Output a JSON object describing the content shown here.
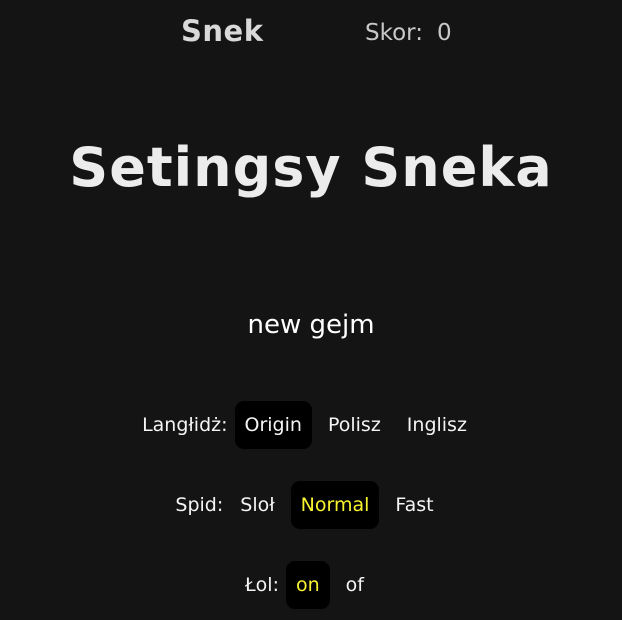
{
  "header": {
    "title": "Snek",
    "score_label": "Skor:",
    "score_value": "0"
  },
  "settings": {
    "heading": "Setingsy Sneka",
    "new_game": "new gejm",
    "language": {
      "label": "Langłidż:",
      "options": [
        "Origin",
        "Polisz",
        "Inglisz"
      ],
      "selected": "Origin"
    },
    "speed": {
      "label": "Spid:",
      "options": [
        "Sloł",
        "Normal",
        "Fast"
      ],
      "selected": "Normal"
    },
    "lol": {
      "label": "Łol:",
      "options": [
        "on",
        "of"
      ],
      "selected": "on"
    }
  },
  "colors": {
    "background": "#141414",
    "highlight": "#f7f32e",
    "selected_bg": "#000000"
  }
}
